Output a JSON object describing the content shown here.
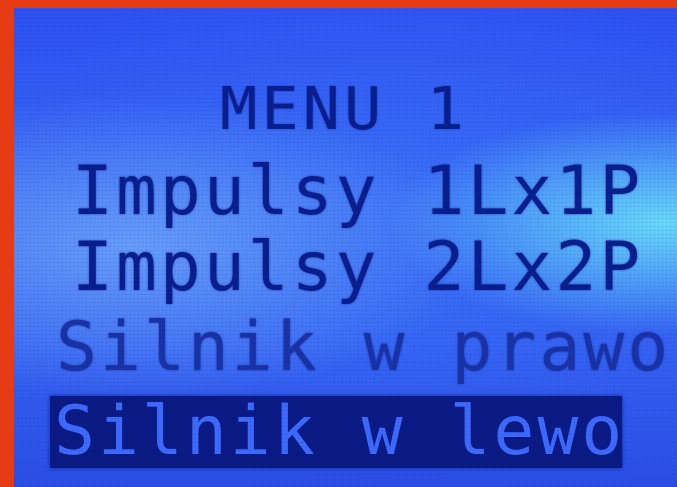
{
  "menu": {
    "title": "MENU 1",
    "items": [
      {
        "label": "Impulsy 1Lx1P",
        "selected": false
      },
      {
        "label": "Impulsy 2Lx2P",
        "selected": false
      },
      {
        "label": "Silnik w prawo",
        "selected": false
      },
      {
        "label": "Silnik w lewo",
        "selected": true
      }
    ]
  },
  "colors": {
    "bezel": "#e63c16",
    "backlight": "#3563f5",
    "pixel_on": "#0a1f8f",
    "selection_bar": "#0a1b86"
  }
}
